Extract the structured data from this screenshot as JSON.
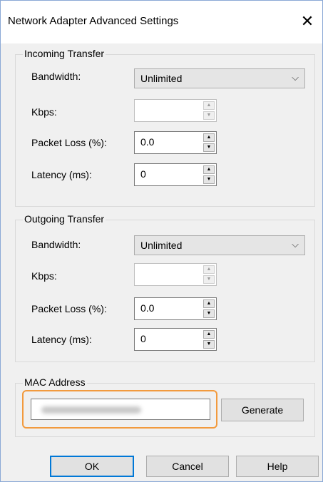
{
  "window": {
    "title": "Network Adapter Advanced Settings",
    "close_glyph": "✕"
  },
  "incoming": {
    "legend": "Incoming Transfer",
    "bandwidth_label": "Bandwidth:",
    "bandwidth_value": "Unlimited",
    "kbps_label": "Kbps:",
    "kbps_value": "",
    "loss_label": "Packet Loss (%):",
    "loss_value": "0.0",
    "latency_label": "Latency (ms):",
    "latency_value": "0"
  },
  "outgoing": {
    "legend": "Outgoing Transfer",
    "bandwidth_label": "Bandwidth:",
    "bandwidth_value": "Unlimited",
    "kbps_label": "Kbps:",
    "kbps_value": "",
    "loss_label": "Packet Loss (%):",
    "loss_value": "0.0",
    "latency_label": "Latency (ms):",
    "latency_value": "0"
  },
  "mac": {
    "legend": "MAC Address",
    "generate_label": "Generate",
    "highlight_color": "#f29a3d"
  },
  "footer": {
    "ok_label": "OK",
    "cancel_label": "Cancel",
    "help_label": "Help"
  },
  "icons": {
    "dropdown": "chevron-down-icon",
    "spin_up": "arrow-up-icon",
    "spin_down": "arrow-down-icon"
  }
}
